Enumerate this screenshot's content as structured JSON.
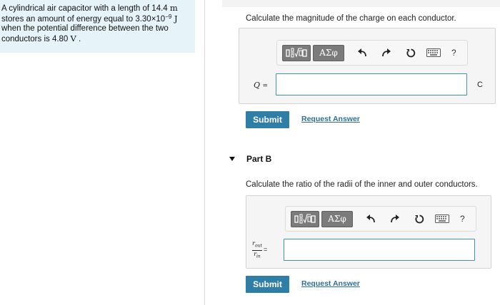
{
  "problem": {
    "line1_text": "A cylindrical air capacitor with a length of 14.4 ",
    "line1_unit": "m",
    "line2_text": "stores an amount of energy equal to 3.30×10",
    "line2_exp": "−9",
    "line2_unit": " J",
    "line3": "when the potential difference between the two",
    "line4_text": "conductors is 4.80 ",
    "line4_unit": "V",
    "line4_end": " ."
  },
  "part_a": {
    "question": "Calculate the magnitude of the charge on each conductor.",
    "toolbar": {
      "greek_label": "ΑΣφ",
      "help_label": "?"
    },
    "variable": "Q",
    "equals": "=",
    "unit": "C",
    "input_value": "",
    "submit_label": "Submit",
    "request_label": "Request Answer"
  },
  "part_b": {
    "title": "Part B",
    "question": "Calculate the ratio of the radii of the inner and outer conductors.",
    "toolbar": {
      "greek_label": "ΑΣφ",
      "help_label": "?"
    },
    "fraction_numerator": "r_out",
    "fraction_denominator": "r_in",
    "equals": "=",
    "input_value": "",
    "submit_label": "Submit",
    "request_label": "Request Answer"
  },
  "icons": {
    "template": "math-template-icon",
    "undo": "undo-icon",
    "redo": "redo-icon",
    "reset": "reset-icon",
    "keyboard": "keyboard-icon",
    "collapse": "caret-down-icon"
  },
  "colors": {
    "problem_bg": "#e6f3f8",
    "submit_bg": "#2e7ea6",
    "link": "#2e6f99",
    "input_border": "#3a93c3",
    "toolbar_button": "#7b7b7b"
  }
}
